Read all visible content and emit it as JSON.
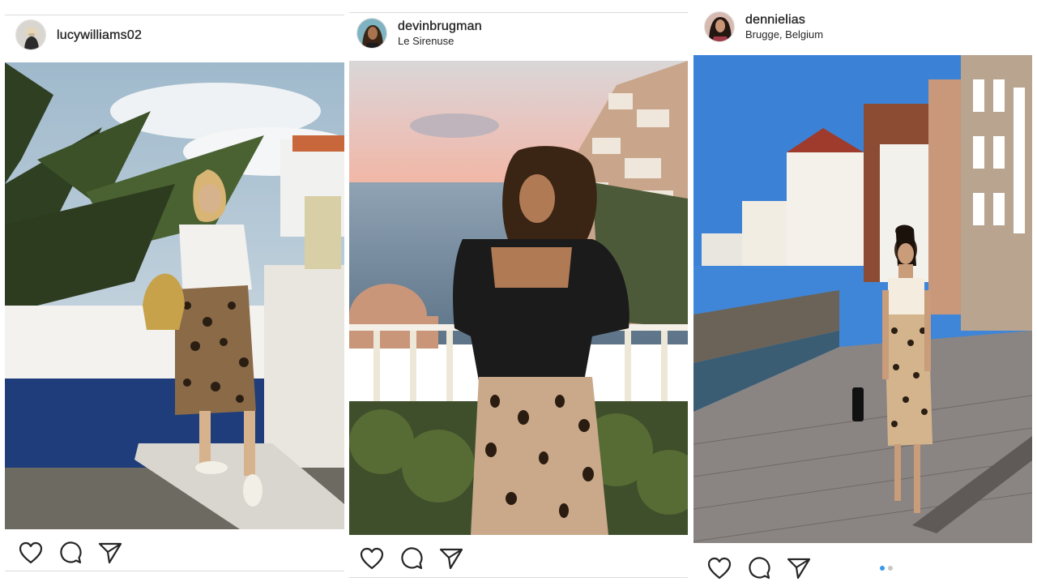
{
  "posts": [
    {
      "username": "lucywilliams02",
      "location": "",
      "avatar_icon": "profile-avatar",
      "photo_icon": "photo-woman-palms-leopard-skirt"
    },
    {
      "username": "devinbrugman",
      "location": "Le Sirenuse",
      "avatar_icon": "profile-avatar",
      "photo_icon": "photo-woman-positano-balcony-leopard-skirt"
    },
    {
      "username": "dennielias",
      "location": "Brugge, Belgium",
      "avatar_icon": "profile-avatar",
      "photo_icon": "photo-woman-brugge-canal-leopard-skirt",
      "carousel": {
        "count": 2,
        "active": 1
      }
    }
  ],
  "icons": {
    "like": "heart-icon",
    "comment": "comment-bubble-icon",
    "share": "paper-plane-icon"
  },
  "colors": {
    "text": "#262626",
    "divider": "#dbdbdb",
    "carousel_active": "#3897f0",
    "carousel_inactive": "#c7c7c7"
  }
}
